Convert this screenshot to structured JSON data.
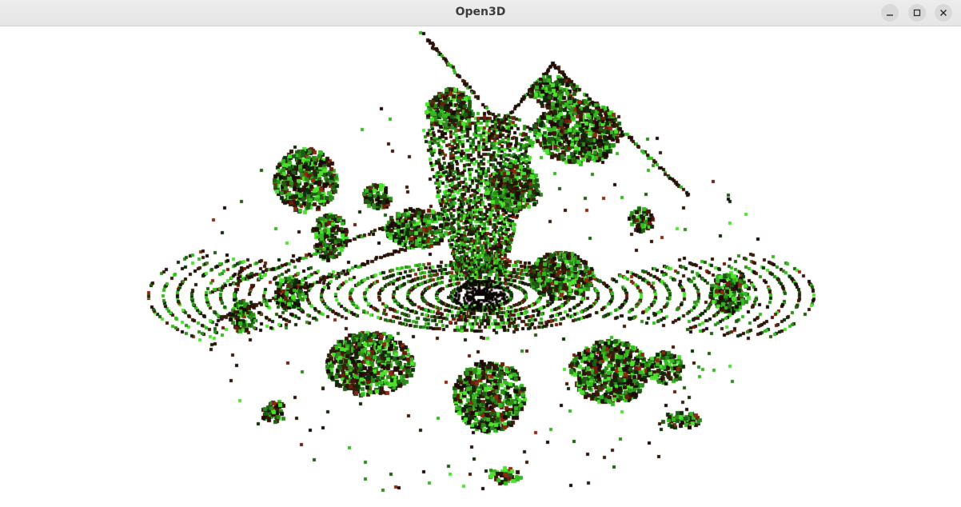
{
  "window": {
    "title": "Open3D",
    "controls": {
      "minimize_icon": "minimize-icon",
      "maximize_icon": "maximize-icon",
      "close_icon": "close-icon"
    }
  },
  "viewport": {
    "content": "lidar-point-cloud",
    "background_color": "#ffffff",
    "point_colors": [
      "#1a0a05",
      "#2a1208",
      "#3a1a0a",
      "#0d2a0a",
      "#1f5c12",
      "#2f8a1c",
      "#36b821",
      "#4be32c",
      "#6a1e0c",
      "#8a2a10"
    ]
  }
}
